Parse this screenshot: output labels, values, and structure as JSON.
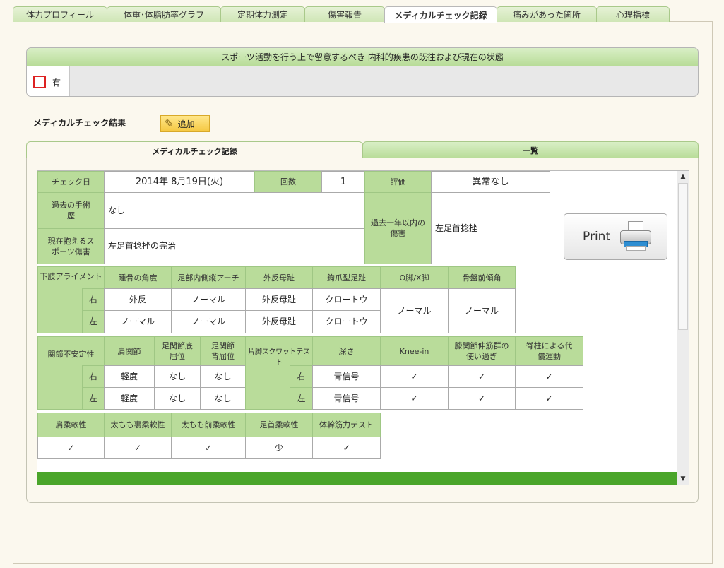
{
  "tabs": [
    {
      "label": "体力プロフィール",
      "active": false
    },
    {
      "label": "体重･体脂肪率グラフ",
      "active": false
    },
    {
      "label": "定期体力測定",
      "active": false
    },
    {
      "label": "傷害報告",
      "active": false
    },
    {
      "label": "メディカルチェック記録",
      "active": true
    },
    {
      "label": "痛みがあった箇所",
      "active": false
    },
    {
      "label": "心理指標",
      "active": false
    }
  ],
  "history": {
    "title": "スポーツ活動を行う上で留意するべき 内科的疾患の既往および現在の状態",
    "checkbox_label": "有"
  },
  "results": {
    "label": "メディカルチェック結果",
    "add_label": "追加"
  },
  "inner_tabs": {
    "record": "メディカルチェック記録",
    "list": "一覧"
  },
  "print_label": "Print",
  "record": {
    "check_date_label": "チェック日",
    "check_date": "2014年 8月19日(火)",
    "count_label": "回数",
    "count": "1",
    "eval_label": "評価",
    "eval": "異常なし",
    "surgery_label": "過去の手術歴",
    "surgery": "なし",
    "current_injury_label": "現在抱えるスポーツ傷害",
    "current_injury": "左足首捻挫の完治",
    "past_year_label": "過去一年以内の傷害",
    "past_year": "左足首捻挫"
  },
  "alignment": {
    "label": "下肢アライメント",
    "headers": [
      "踵骨の角度",
      "足部内側縦アーチ",
      "外反母趾",
      "鉤爪型足趾",
      "O脚/X脚",
      "骨盤前傾角"
    ],
    "right_label": "右",
    "left_label": "左",
    "right": [
      "外反",
      "ノーマル",
      "外反母趾",
      "クロートウ"
    ],
    "left": [
      "ノーマル",
      "ノーマル",
      "外反母趾",
      "クロートウ"
    ],
    "merged": [
      "ノーマル",
      "ノーマル"
    ]
  },
  "instability": {
    "label": "関節不安定性",
    "headers": [
      "肩関節",
      "足関節底屈位",
      "足関節背屈位"
    ],
    "right_label": "右",
    "left_label": "左",
    "right": [
      "軽度",
      "なし",
      "なし"
    ],
    "left": [
      "軽度",
      "なし",
      "なし"
    ]
  },
  "squat": {
    "label": "片脚スクワットテスト",
    "headers": [
      "深さ",
      "Knee-in",
      "膝関節伸筋群の使い過ぎ",
      "脊柱による代償運動"
    ],
    "right_label": "右",
    "left_label": "左",
    "right": [
      "青信号",
      "✓",
      "✓",
      "✓"
    ],
    "left": [
      "青信号",
      "✓",
      "✓",
      "✓"
    ]
  },
  "flex": {
    "headers": [
      "肩柔軟性",
      "太もも裏柔軟性",
      "太もも前柔軟性",
      "足首柔軟性",
      "体幹筋力テスト"
    ],
    "values": [
      "✓",
      "✓",
      "✓",
      "少",
      "✓"
    ]
  },
  "icons": {
    "add": "pencil-icon",
    "print": "printer-icon",
    "scroll_up": "scroll-up-arrow-icon",
    "scroll_down": "scroll-down-arrow-icon"
  },
  "colors": {
    "tab_green": "#cfe6b6",
    "header_green": "#b9dc9a",
    "bar_green": "#4aa52a",
    "checkbox_red": "#dd2222",
    "add_yellow": "#f5c842"
  }
}
